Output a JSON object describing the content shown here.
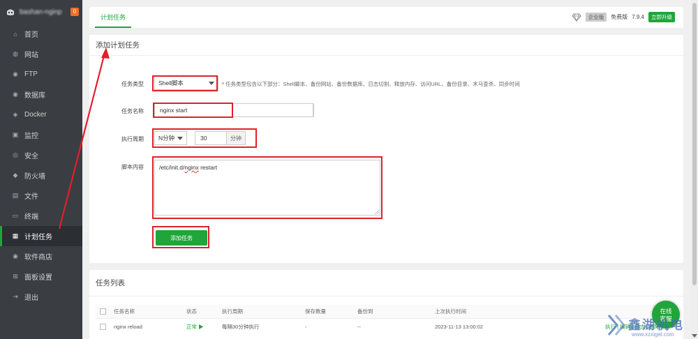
{
  "sidebar": {
    "host": "bashan-nginp",
    "badge": "0",
    "items": [
      {
        "label": "首页",
        "icon": "home-icon"
      },
      {
        "label": "网站",
        "icon": "globe-icon"
      },
      {
        "label": "FTP",
        "icon": "ftp-icon"
      },
      {
        "label": "数据库",
        "icon": "database-icon"
      },
      {
        "label": "Docker",
        "icon": "docker-icon"
      },
      {
        "label": "监控",
        "icon": "monitor-icon"
      },
      {
        "label": "安全",
        "icon": "shield-icon"
      },
      {
        "label": "防火墙",
        "icon": "firewall-icon"
      },
      {
        "label": "文件",
        "icon": "folder-icon"
      },
      {
        "label": "终端",
        "icon": "terminal-icon"
      },
      {
        "label": "计划任务",
        "icon": "calendar-icon",
        "active": true
      },
      {
        "label": "软件商店",
        "icon": "store-icon"
      },
      {
        "label": "面板设置",
        "icon": "settings-icon"
      },
      {
        "label": "退出",
        "icon": "logout-icon"
      }
    ]
  },
  "topbar": {
    "tab": "计划任务",
    "enterprise": "企业版",
    "edition": "免费版",
    "version": "7.9.4",
    "upgrade": "立即升级"
  },
  "form": {
    "title": "添加计划任务",
    "task_type_label": "任务类型",
    "task_type_value": "Shell脚本",
    "hint_star": "*",
    "hint": "任务类型包含以下部分：Shell脚本、备份网站、备份数据库、日志切割、释放内存、访问URL、备份目录、木马查杀、同步时间",
    "task_name_label": "任务名称",
    "task_name_value": "nginx start",
    "cycle_label": "执行周期",
    "cycle_select": "N分钟",
    "cycle_value": "30",
    "cycle_unit": "分钟",
    "script_label": "脚本内容",
    "script_prefix": "/etc/init.d/",
    "script_word": "nginx",
    "script_suffix": " restart",
    "submit": "添加任务"
  },
  "task_list": {
    "title": "任务列表",
    "columns": [
      "任务名称",
      "状态",
      "执行周期",
      "保存数量",
      "备份到",
      "上次执行时间"
    ],
    "rows": [
      {
        "name": "nginx reload",
        "status": "正常",
        "cycle": "每隔30分钟执行",
        "keep": "-",
        "backup": "--",
        "last": "2023-11-13 13:00:02",
        "ops": "执行 | 编辑 | 日志 | 删除"
      }
    ]
  },
  "chat": {
    "line1": "在线",
    "line2": "客服"
  },
  "watermark": {
    "text": "鑫",
    "text2": "湖机电",
    "url": "www.xzxigel.com"
  },
  "colors": {
    "accent": "#20a53a",
    "annotation": "#e0202c",
    "sidebar_bg": "#3a3d42"
  }
}
